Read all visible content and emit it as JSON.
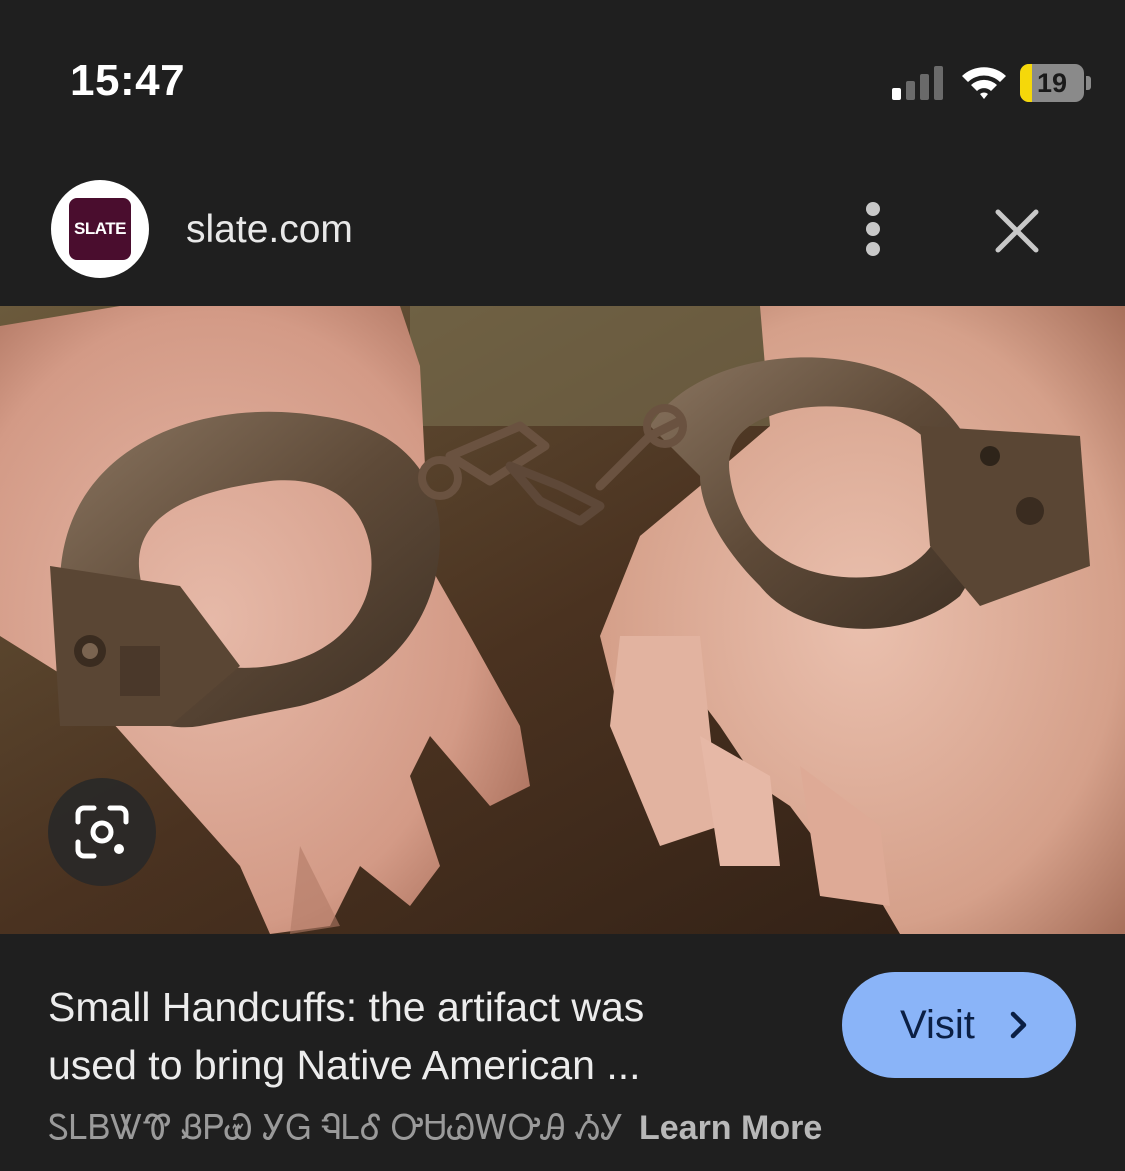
{
  "status_bar": {
    "time": "15:47",
    "battery_level": "19",
    "battery_fraction": 0.19,
    "signal_icon": "cellular-signal-icon",
    "wifi_icon": "wifi-icon"
  },
  "source": {
    "logo_text": "SLATE",
    "name": "slate.com",
    "more_icon": "more-vertical-icon",
    "close_icon": "close-icon"
  },
  "image": {
    "lens_icon": "google-lens-icon"
  },
  "caption": {
    "title_line1": "Small Handcuffs: the artifact was",
    "title_line2": "used to bring Native American ...",
    "visit_label": "Visit",
    "footer_text": "ᏚᏞᏴᏔᏡ ᏰᏢᏯ ᎩᏀ ᏄᏞᎴ ᎤᏌᏊᎳᎤᎯ ᏱᎩ",
    "learn_more": "Learn More"
  },
  "colors": {
    "background": "#1f1f1f",
    "visit_button": "#8ab4f8",
    "battery_low": "#f5d80a",
    "slate_brand": "#4a0d2e"
  }
}
